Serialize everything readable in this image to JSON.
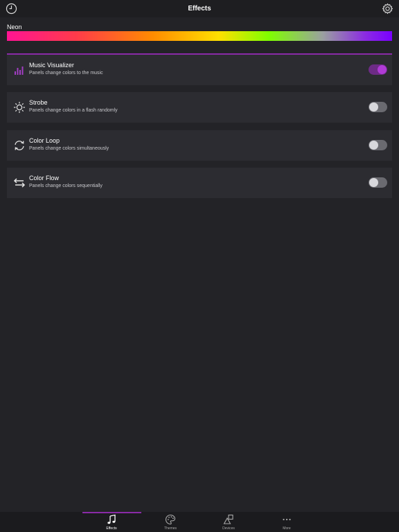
{
  "header": {
    "title": "Effects",
    "left_icon": "clock-icon",
    "right_icon": "gear-icon"
  },
  "theme": {
    "label": "Neon"
  },
  "effects": [
    {
      "title": "Music Visualizer",
      "subtitle": "Panels change colors to the music",
      "icon": "bar-chart-icon",
      "enabled": true
    },
    {
      "title": "Strobe",
      "subtitle": "Panels change colors in a flash randomly",
      "icon": "sun-icon",
      "enabled": false
    },
    {
      "title": "Color Loop",
      "subtitle": "Panels change colors simultaneously",
      "icon": "refresh-icon",
      "enabled": false
    },
    {
      "title": "Color Flow",
      "subtitle": "Panels change colors sequentially",
      "icon": "swap-arrows-icon",
      "enabled": false
    }
  ],
  "tabs": [
    {
      "label": "Effects",
      "icon": "music-note-icon",
      "active": true
    },
    {
      "label": "Themes",
      "icon": "palette-icon",
      "active": false
    },
    {
      "label": "Devices",
      "icon": "shapes-icon",
      "active": false
    },
    {
      "label": "More",
      "icon": "more-dots-icon",
      "active": false
    }
  ],
  "colors": {
    "accent": "#8a2aa8",
    "toggle_on": "#b03bd6",
    "background": "#232327",
    "card": "#2c2c31"
  }
}
